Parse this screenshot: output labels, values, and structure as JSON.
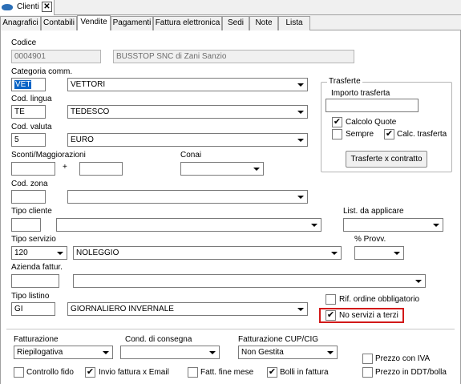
{
  "window": {
    "tab_label": "Clienti",
    "close_glyph": "✕",
    "icon": "app-fish-icon"
  },
  "tabs": [
    {
      "label": "Anagrafici"
    },
    {
      "label": "Contabili"
    },
    {
      "label": "Vendite"
    },
    {
      "label": "Pagamenti"
    },
    {
      "label": "Fattura elettronica"
    },
    {
      "label": "Sedi"
    },
    {
      "label": "Note"
    },
    {
      "label": "Lista"
    }
  ],
  "codice": {
    "label": "Codice",
    "value": "0004901",
    "name": "BUSSTOP SNC di Zani Sanzio"
  },
  "categoria": {
    "label": "Categoria comm.",
    "code": "VET",
    "desc": "VETTORI"
  },
  "lingua": {
    "label": "Cod. lingua",
    "code": "TE",
    "desc": "TEDESCO"
  },
  "valuta": {
    "label": "Cod. valuta",
    "code": "5",
    "desc": "EURO"
  },
  "sconti": {
    "label": "Sconti/Maggiorazioni",
    "value1": "",
    "sep": "+",
    "value2": ""
  },
  "conai": {
    "label": "Conai",
    "value": ""
  },
  "zona": {
    "label": "Cod. zona",
    "code": "",
    "desc": ""
  },
  "tipo_cliente": {
    "label": "Tipo  cliente",
    "code": "",
    "desc": ""
  },
  "listino_applicare": {
    "label": "List. da applicare",
    "value": ""
  },
  "tipo_servizio": {
    "label": "Tipo servizio",
    "code": "120",
    "desc": "NOLEGGIO"
  },
  "provv": {
    "label": "% Provv.",
    "value": ""
  },
  "azienda_fattur": {
    "label": "Azienda fattur.",
    "code": "",
    "desc": ""
  },
  "tipo_listino": {
    "label": "Tipo listino",
    "code": "GI",
    "desc": "GIORNALIERO INVERNALE"
  },
  "trasferte": {
    "title": "Trasferte",
    "importo_label": "Importo trasferta",
    "importo_value": "",
    "calcolo_quote": {
      "label": "Calcolo Quote",
      "checked": true
    },
    "sempre": {
      "label": "Sempre",
      "checked": false
    },
    "calc_trasferta": {
      "label": "Calc. trasferta",
      "checked": true
    },
    "button_label": "Trasferte x contratto"
  },
  "rif_ordine": {
    "label": "Rif. ordine obbligatorio",
    "checked": false
  },
  "no_servizi": {
    "label": "No servizi a terzi",
    "checked": true
  },
  "fatturazione": {
    "label": "Fatturazione",
    "value": "Riepilogativa"
  },
  "cond_consegna": {
    "label": "Cond. di consegna",
    "value": ""
  },
  "fatt_cup": {
    "label": "Fatturazione CUP/CIG",
    "value": "Non Gestita"
  },
  "prezzo_iva": {
    "label": "Prezzo con IVA",
    "checked": false
  },
  "prezzo_ddt": {
    "label": "Prezzo in DDT/bolla",
    "checked": false
  },
  "controllo_fido": {
    "label": "Controllo fido",
    "checked": false
  },
  "invio_fattura": {
    "label": "Invio fattura x Email",
    "checked": true
  },
  "fatt_fine_mese": {
    "label": "Fatt. fine mese",
    "checked": false
  },
  "bolli_fattura": {
    "label": "Bolli in fattura",
    "checked": true
  },
  "check_glyph": "✔",
  "colors": {
    "highlight": "#d21919",
    "selection": "#0a64c6"
  }
}
